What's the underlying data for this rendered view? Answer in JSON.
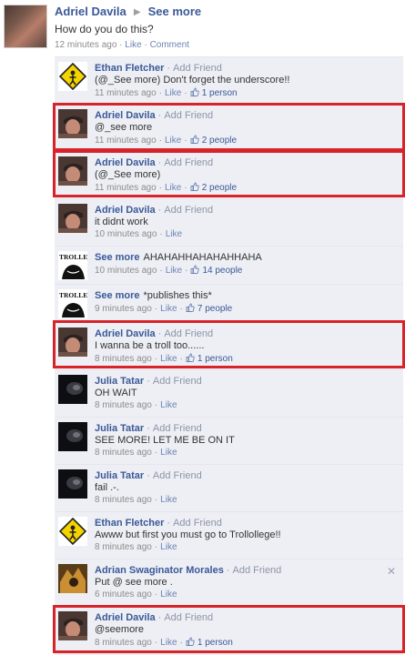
{
  "post": {
    "author": "Adriel Davila",
    "arrow": "▶",
    "target": "See more",
    "text": "How do you do this?",
    "time": "12 minutes ago",
    "like": "Like",
    "comment": "Comment"
  },
  "separator": "·",
  "add_friend": "Add Friend",
  "like": "Like",
  "thumb_icon": "👍",
  "close_icon": "✕",
  "highlight_color": "#d8232a",
  "link_color": "#3b5998",
  "comments": [
    {
      "author": "Ethan Fletcher",
      "add_friend": true,
      "text": "(@_See more) Don't forget the underscore!!",
      "inline": true,
      "time": "11 minutes ago",
      "people": "1 person",
      "avatar": "ethan"
    },
    {
      "author": "Adriel Davila",
      "add_friend": true,
      "text": "@_see more",
      "inline": false,
      "time": "11 minutes ago",
      "people": "2 people",
      "avatar": "adriel"
    },
    {
      "author": "Adriel Davila",
      "add_friend": true,
      "text": "(@_See more)",
      "inline": false,
      "time": "11 minutes ago",
      "people": "2 people",
      "avatar": "adriel"
    },
    {
      "author": "Adriel Davila",
      "add_friend": true,
      "text": "it didnt work",
      "inline": false,
      "time": "10 minutes ago",
      "people": "",
      "avatar": "adriel"
    },
    {
      "author": "See more",
      "add_friend": false,
      "text": "AHAHAHHAHAHAHHAHA",
      "inline": true,
      "time": "10 minutes ago",
      "people": "14 people",
      "avatar": "seemore"
    },
    {
      "author": "See more",
      "add_friend": false,
      "text": "*publishes this*",
      "inline": true,
      "time": "9 minutes ago",
      "people": "7 people",
      "avatar": "seemore"
    },
    {
      "author": "Adriel Davila",
      "add_friend": true,
      "text": "I wanna be a troll too......",
      "inline": false,
      "time": "8 minutes ago",
      "people": "1 person",
      "avatar": "adriel"
    },
    {
      "author": "Julia Tatar",
      "add_friend": true,
      "text": "OH WAIT",
      "inline": false,
      "time": "8 minutes ago",
      "people": "",
      "avatar": "julia"
    },
    {
      "author": "Julia Tatar",
      "add_friend": true,
      "text": "SEE MORE! LET ME BE ON IT",
      "inline": false,
      "time": "8 minutes ago",
      "people": "",
      "avatar": "julia"
    },
    {
      "author": "Julia Tatar",
      "add_friend": true,
      "text": "fail .-.",
      "inline": false,
      "time": "8 minutes ago",
      "people": "",
      "avatar": "julia"
    },
    {
      "author": "Ethan Fletcher",
      "add_friend": true,
      "text": "Awww but first you must go to Trollollege!!",
      "inline": false,
      "time": "8 minutes ago",
      "people": "",
      "avatar": "ethan"
    },
    {
      "author": "Adrian Swaginator Morales",
      "add_friend": true,
      "text": "Put @ see more .",
      "inline": false,
      "time": "6 minutes ago",
      "people": "",
      "avatar": "adrian",
      "close": true
    },
    {
      "author": "Adriel Davila",
      "add_friend": true,
      "text": "@seemore",
      "inline": false,
      "time": "8 minutes ago",
      "people": "1 person",
      "avatar": "adriel"
    }
  ],
  "trollface_label": "TROLLED",
  "caution_sign": "sign"
}
